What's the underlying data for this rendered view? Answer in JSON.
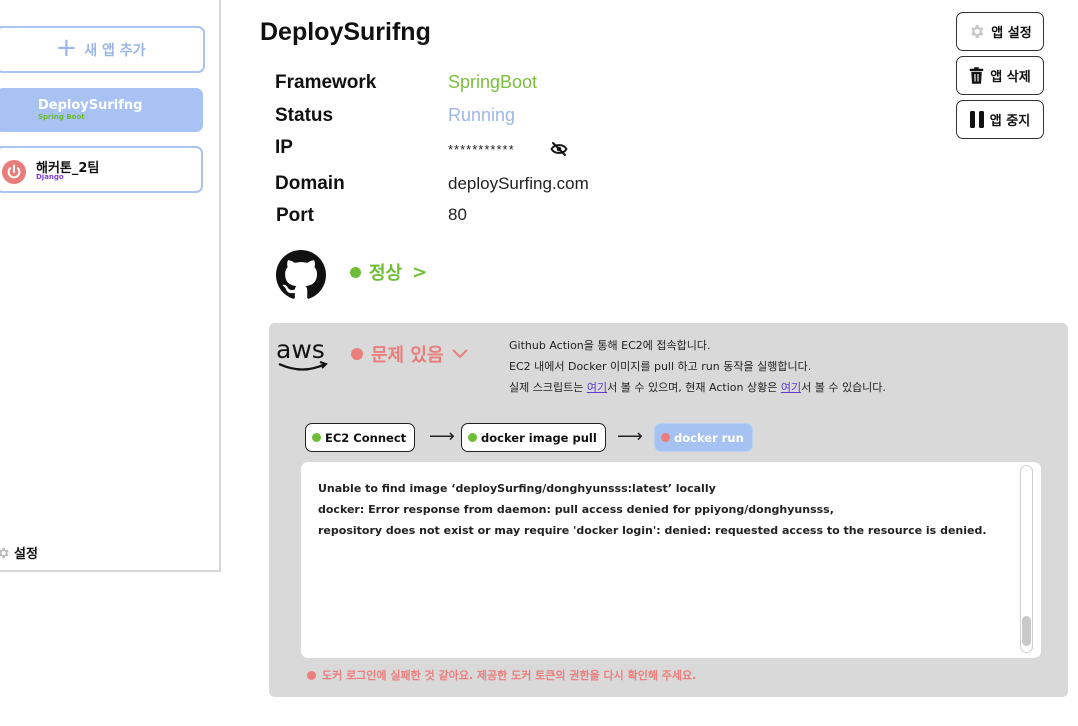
{
  "sidebar": {
    "new_app_label": "새 앱 추가",
    "apps": [
      {
        "name": "DeploySurifng",
        "framework": "Spring Boot",
        "state": "active"
      },
      {
        "name": "해커톤_2팀",
        "framework": "Django",
        "state": "stopped"
      }
    ],
    "settings_label": "설정"
  },
  "header": {
    "title": "DeploySurifng"
  },
  "info": {
    "framework_label": "Framework",
    "framework_value": "SpringBoot",
    "status_label": "Status",
    "status_value": "Running",
    "ip_label": "IP",
    "ip_value": "***********",
    "domain_label": "Domain",
    "domain_value": "deploySurfing.com",
    "port_label": "Port",
    "port_value": "80"
  },
  "actions": {
    "settings_label": "앱 설정",
    "delete_label": "앱 삭제",
    "stop_label": "앱 중지"
  },
  "github": {
    "status_label": "정상",
    "chevron": ">"
  },
  "aws": {
    "status_label": "문제 있음",
    "desc_line1": "Github Action을 통해 EC2에 접속합니다.",
    "desc_line2": "EC2 내에서 Docker 이미지를 pull 하고 run 동작을 실행합니다.",
    "desc_line3_a": "실제 스크립트는 ",
    "desc_link1": "여기",
    "desc_line3_b": "서 볼 수 있으며, 현재 Action 상황은 ",
    "desc_link2": "여기",
    "desc_line3_c": "서 볼 수 있습니다.",
    "steps": [
      {
        "label": "EC2 Connect",
        "status": "success"
      },
      {
        "label": "docker image pull",
        "status": "success"
      },
      {
        "label": "docker run",
        "status": "failed"
      }
    ],
    "log_lines": [
      "Unable to find image ‘deploySurfing/donghyunsss:latest’ locally",
      "docker: Error response from daemon: pull access denied for ppiyong/donghyunsss,",
      "repository does not exist or may require 'docker login': denied: requested access to the resource is denied."
    ],
    "error_message": "도커 로그인에 실패한 것 같아요. 제공한 도커 토큰의 권한을 다시 확인해 주세요."
  },
  "colors": {
    "accent_blue": "#a8c3f3",
    "success_green": "#6dbd37",
    "error_red": "#eb7d7b",
    "panel_gray": "#d9d9d9"
  }
}
